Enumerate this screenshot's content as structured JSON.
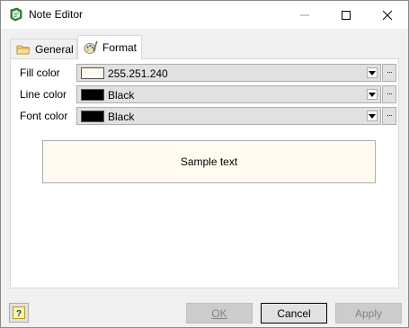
{
  "window": {
    "title": "Note Editor"
  },
  "tabs": [
    {
      "label": "General",
      "icon": "folder-icon",
      "selected": false
    },
    {
      "label": "Format",
      "icon": "palette-icon",
      "selected": true
    }
  ],
  "format": {
    "fill_color": {
      "label": "Fill color",
      "value": "255.251.240",
      "swatch": "#fffbf0"
    },
    "line_color": {
      "label": "Line color",
      "value": "Black",
      "swatch": "#000000"
    },
    "font_color": {
      "label": "Font color",
      "value": "Black",
      "swatch": "#000000"
    },
    "more_label": "···"
  },
  "sample": {
    "text": "Sample text",
    "background": "#fffbf0"
  },
  "buttons": {
    "help": "?",
    "ok": "OK",
    "cancel": "Cancel",
    "apply": "Apply"
  }
}
